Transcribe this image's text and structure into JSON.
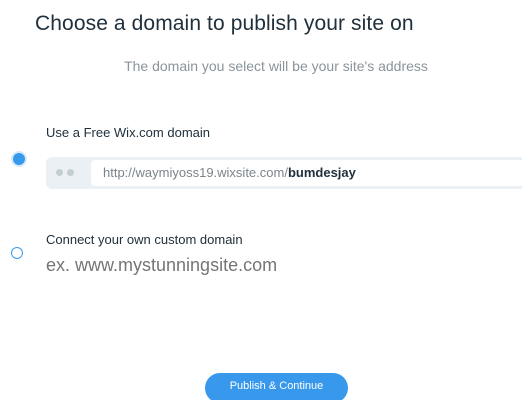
{
  "header": {
    "title": "Choose a domain to publish your site on",
    "subtitle": "The domain you select will be your site's address"
  },
  "options": {
    "free": {
      "label": "Use a Free Wix.com domain",
      "selected": true,
      "url_prefix": "http://waymiyoss19.wixsite.com/",
      "site_name": "bumdesjay"
    },
    "custom": {
      "label": "Connect your own custom domain",
      "selected": false,
      "placeholder": "ex. www.mystunningsite.com"
    }
  },
  "actions": {
    "publish_label": "Publish & Continue"
  },
  "colors": {
    "accent": "#3899ec",
    "text": "#20303c",
    "muted": "#8a949c"
  }
}
